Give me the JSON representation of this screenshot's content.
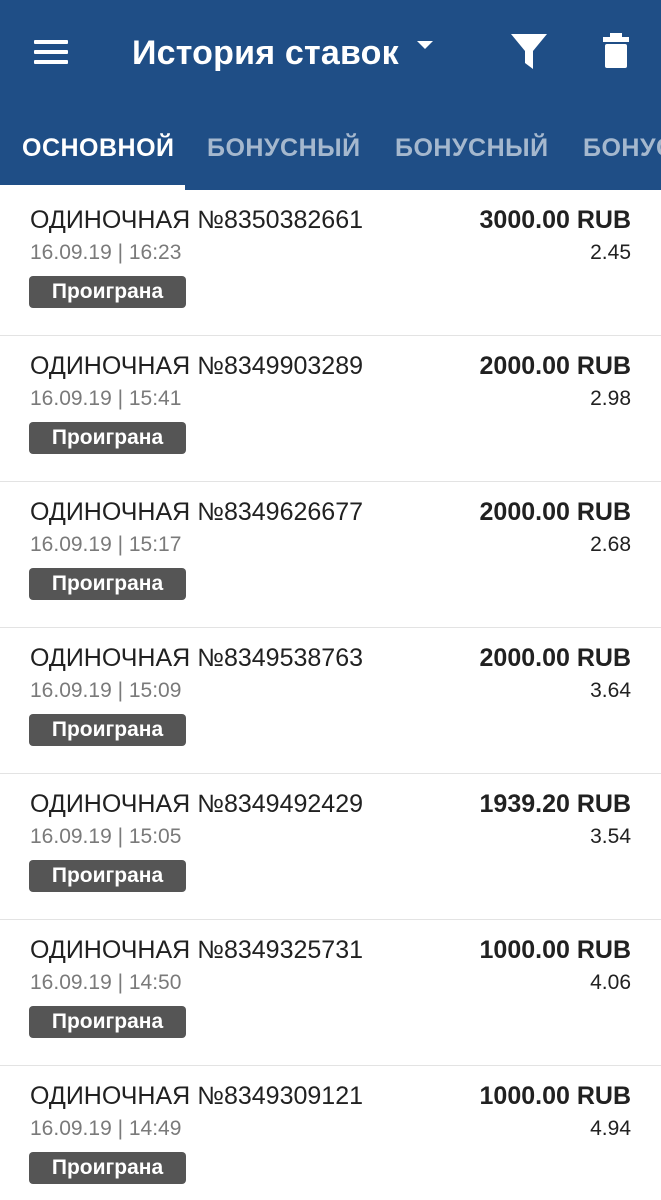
{
  "header": {
    "title": "История ставок",
    "menu_icon": "hamburger-menu-icon",
    "filter_icon": "filter-icon",
    "trash_icon": "trash-icon",
    "background_color": "#1f4e86"
  },
  "tabs": [
    {
      "label": "ОСНОВНОЙ",
      "active": true
    },
    {
      "label": "БОНУСНЫЙ",
      "active": false
    },
    {
      "label": "БОНУСНЫЙ",
      "active": false
    },
    {
      "label": "БОНУС",
      "active": false
    }
  ],
  "bets": [
    {
      "type": "ОДИНОЧНАЯ №8350382661",
      "datetime": "16.09.19 | 16:23",
      "status": "Проиграна",
      "amount": "3000.00 RUB",
      "coefficient": "2.45"
    },
    {
      "type": "ОДИНОЧНАЯ №8349903289",
      "datetime": "16.09.19 | 15:41",
      "status": "Проиграна",
      "amount": "2000.00 RUB",
      "coefficient": "2.98"
    },
    {
      "type": "ОДИНОЧНАЯ №8349626677",
      "datetime": "16.09.19 | 15:17",
      "status": "Проиграна",
      "amount": "2000.00 RUB",
      "coefficient": "2.68"
    },
    {
      "type": "ОДИНОЧНАЯ №8349538763",
      "datetime": "16.09.19 | 15:09",
      "status": "Проиграна",
      "amount": "2000.00 RUB",
      "coefficient": "3.64"
    },
    {
      "type": "ОДИНОЧНАЯ №8349492429",
      "datetime": "16.09.19 | 15:05",
      "status": "Проиграна",
      "amount": "1939.20 RUB",
      "coefficient": "3.54"
    },
    {
      "type": "ОДИНОЧНАЯ №8349325731",
      "datetime": "16.09.19 | 14:50",
      "status": "Проиграна",
      "amount": "1000.00 RUB",
      "coefficient": "4.06"
    },
    {
      "type": "ОДИНОЧНАЯ №8349309121",
      "datetime": "16.09.19 | 14:49",
      "status": "Проиграна",
      "amount": "1000.00 RUB",
      "coefficient": "4.94"
    }
  ]
}
